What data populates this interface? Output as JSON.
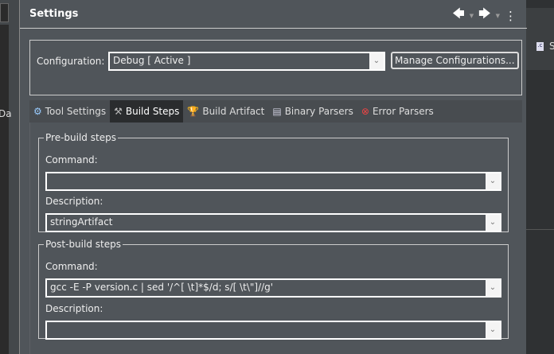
{
  "left_panel": {
    "partial_text": "Da"
  },
  "right_panel": {
    "tab_label": "S",
    "tab_icon": "c-file-icon"
  },
  "dialog": {
    "title": "Settings",
    "configuration": {
      "label": "Configuration:",
      "value": "Debug  [ Active ]",
      "manage_button": "Manage Configurations..."
    },
    "tabs": [
      {
        "label": "Tool Settings",
        "icon": "gear-icon",
        "active": false
      },
      {
        "label": "Build Steps",
        "icon": "hammer-icon",
        "active": true
      },
      {
        "label": "Build Artifact",
        "icon": "trophy-icon",
        "active": false
      },
      {
        "label": "Binary Parsers",
        "icon": "binary-file-icon",
        "active": false
      },
      {
        "label": "Error Parsers",
        "icon": "error-icon",
        "active": false
      }
    ],
    "pre_build": {
      "legend": "Pre-build steps",
      "command_label": "Command:",
      "command_value": "",
      "description_label": "Description:",
      "description_value": "stringArtifact"
    },
    "post_build": {
      "legend": "Post-build steps",
      "command_label": "Command:",
      "command_value": "gcc -E -P version.c | sed '/^[ \\t]*$/d; s/[ \\t\\\"]//g'",
      "description_label": "Description:",
      "description_value": ""
    }
  }
}
